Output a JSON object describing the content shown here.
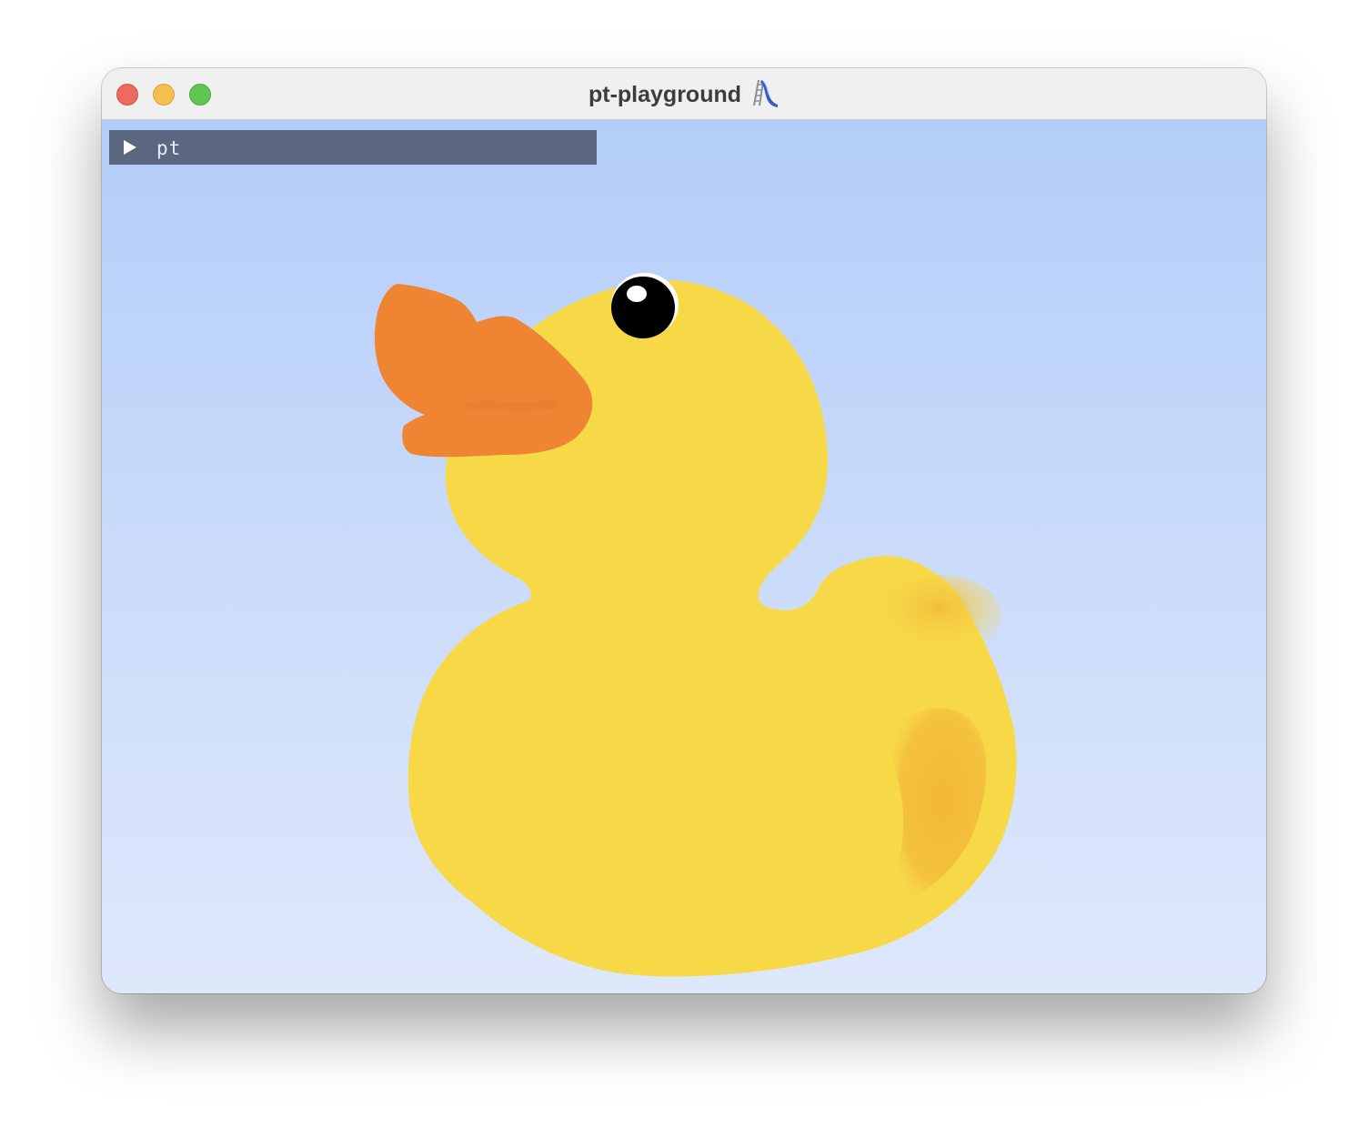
{
  "window": {
    "title": "pt-playground",
    "title_icon": "playground-slide-icon",
    "buttons": [
      "close",
      "minimize",
      "zoom"
    ]
  },
  "panel": {
    "label": "pt",
    "expanded": false,
    "toggle_icon": "play-triangle-icon"
  },
  "scene": {
    "subject": "rubber-duck",
    "colors": {
      "sky_top": "#b3cdfa",
      "sky_bottom": "#dfe8fb",
      "duck_body": "#f7d948",
      "duck_shade": "#f2b838",
      "beak": "#ef8533",
      "eye": "#000000",
      "panel_bg": "#5b6780"
    }
  }
}
